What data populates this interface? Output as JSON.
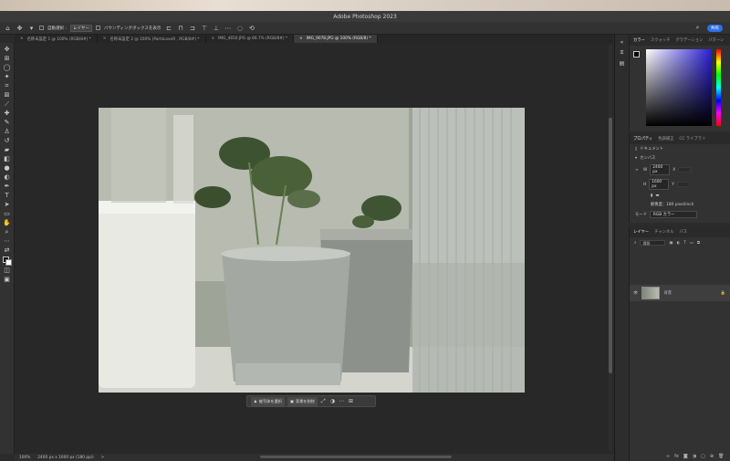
{
  "app": {
    "title": "Adobe Photoshop 2023",
    "share_label": "共有"
  },
  "options_bar": {
    "auto_select_label": "自動選択 :",
    "layer_select": "レイヤー",
    "transform_label": "バウンディングボックスを表示"
  },
  "tabs": [
    {
      "label": "名称未設定 1 @ 100% (RGB/8#) *",
      "close": "×"
    },
    {
      "label": "名称未設定 2 @ 100% (PartsLoveR , RGB/8#) *",
      "close": "×"
    },
    {
      "label": "IMG_4650.JPG @ 66.7% (RGB/8#) *",
      "close": "×"
    },
    {
      "label": "IMG_9078.JPG @ 100% (RGB/8) *",
      "close": "×"
    }
  ],
  "context_bar": {
    "select_subject": "被写体を選択",
    "remove_bg": "背景を削除"
  },
  "status": {
    "zoom": "100%",
    "doc_info": "2400 px x 1600 px (180 ppi)",
    "arrow": ">"
  },
  "color_panel": {
    "tabs": [
      "カラー",
      "スウォッチ",
      "グラデーション",
      "パターン"
    ]
  },
  "properties": {
    "tabs": [
      "プロパティ",
      "色調補正",
      "CC ライブラリ"
    ],
    "doc_label": "ドキュメント",
    "section": "カンバス",
    "w_label": "W",
    "w_value": "2400 px",
    "h_label": "H",
    "h_value": "1600 px",
    "x_label": "X",
    "y_label": "Y",
    "resolution": "解像度：180 pixel/inch",
    "mode_label": "モード",
    "mode_value": "RGB カラー"
  },
  "layers_panel": {
    "tabs": [
      "レイヤー",
      "チャンネル",
      "パス"
    ],
    "filter_placeholder": "種類",
    "layer_name": "背景"
  },
  "colors": {
    "accent": "#2f6fe4",
    "panel_bg": "#323232",
    "canvas_bg": "#282828"
  }
}
